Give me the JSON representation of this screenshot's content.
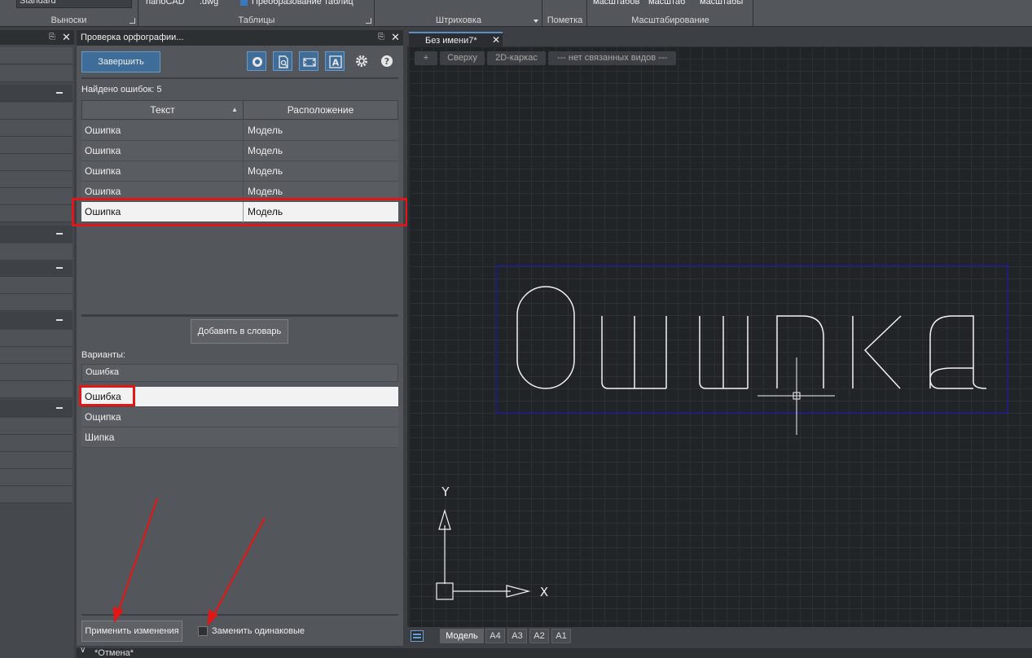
{
  "ribbon": {
    "combo_standard": "Standard",
    "label_vynoski": "Выноски",
    "top_nanocad": "nanoCAD",
    "top_dwg": ".dwg",
    "top_table_convert": "Преобразование таблиц",
    "label_tables": "Таблицы",
    "label_hatch": "Штриховка",
    "label_markup": "Пометка",
    "top_scale1": "масштабов",
    "top_scale2": "масштаб",
    "top_scale3": "масштабы",
    "label_scaling": "Масштабирование"
  },
  "spell_panel": {
    "title": "Проверка орфографии...",
    "finish_button": "Завершить",
    "errors_found": "Найдено ошибок: 5",
    "col_text": "Текст",
    "col_location": "Расположение",
    "rows": [
      {
        "text": "Ошипка",
        "location": "Модель"
      },
      {
        "text": "Ошипка",
        "location": "Модель"
      },
      {
        "text": "Ошипка",
        "location": "Модель"
      },
      {
        "text": "Ошипка",
        "location": "Модель"
      },
      {
        "text": "Ошипка",
        "location": "Модель"
      }
    ],
    "add_to_dictionary": "Добавить в словарь",
    "variants_label": "Варианты:",
    "variant_input_value": "Ошибка",
    "variants": [
      "Ошибка",
      "Ощипка",
      "Шипка"
    ],
    "apply_button": "Применить изменения",
    "replace_same_label": "Заменить одинаковые"
  },
  "document": {
    "tab_title": "Без имени7*",
    "view_plus": "+",
    "view_top": "Сверху",
    "view_style": "2D-каркас",
    "view_linked": "--- нет связанных видов ---",
    "drawing_text": "Ошипка",
    "axis_y": "Y",
    "axis_x": "X",
    "layout_tabs": [
      "Модель",
      "A4",
      "A3",
      "A2",
      "A1"
    ]
  },
  "status": {
    "text": "*Отмена*"
  },
  "colors": {
    "accent": "#3f6d99",
    "highlight_red": "#e11616",
    "selection_frame": "#1a1aa8"
  }
}
